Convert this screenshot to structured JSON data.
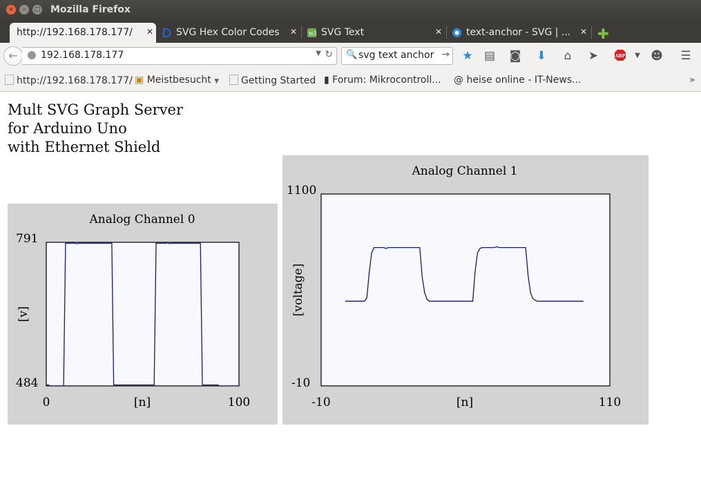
{
  "window": {
    "title": "Mozilla Firefox"
  },
  "tabs": [
    {
      "label": "http://192.168.178.177/",
      "active": true,
      "icon": "none"
    },
    {
      "label": "SVG Hex Color Codes",
      "active": false,
      "icon": "d-logo-icon"
    },
    {
      "label": "SVG Text",
      "active": false,
      "icon": "w3-icon"
    },
    {
      "label": "text-anchor - SVG | ...",
      "active": false,
      "icon": "mdn-icon"
    }
  ],
  "navigation": {
    "url": "192.168.178.177",
    "search_value": "svg text anchor"
  },
  "bookmarks": [
    {
      "label": "http://192.168.178.177/"
    },
    {
      "label": "Meistbesucht"
    },
    {
      "label": "Getting Started"
    },
    {
      "label": "Forum: Mikrocontroll..."
    },
    {
      "label": "heise online - IT-News..."
    }
  ],
  "page": {
    "title_lines": [
      "Mult SVG Graph Server",
      "for Arduino Uno",
      "with Ethernet Shield"
    ]
  },
  "colors": {
    "panel": "#d3d3d3",
    "plot_bg": "#f8f8ff",
    "line": "#191970"
  },
  "chart_data": [
    {
      "type": "line",
      "title": "Analog Channel 0",
      "xlabel": "[n]",
      "ylabel": "[v]",
      "xlim": [
        0,
        100
      ],
      "ylim": [
        484,
        791
      ],
      "x_tick_labels": [
        "0",
        "100"
      ],
      "y_tick_labels": [
        "791",
        "484"
      ],
      "grid": false,
      "series": [
        {
          "x": [
            0,
            1,
            2,
            3,
            4,
            5,
            6,
            7,
            8,
            9,
            10,
            11,
            12,
            13,
            14,
            15,
            16,
            17,
            18,
            19,
            20,
            21,
            22,
            23,
            24,
            25,
            26,
            27,
            28,
            29,
            30,
            31,
            32,
            33,
            34,
            35,
            36,
            37,
            38,
            39,
            40,
            41,
            42,
            43,
            44,
            45,
            46,
            47,
            48,
            49,
            50,
            51,
            52,
            53,
            54,
            55,
            56,
            57,
            58,
            59,
            60,
            61,
            62,
            63,
            64,
            65,
            66,
            67,
            68,
            69,
            70,
            71,
            72,
            73,
            74,
            75,
            76,
            77,
            78,
            79,
            80,
            81,
            82,
            83,
            84,
            85,
            86,
            87,
            88,
            89,
            90,
            91,
            92,
            93,
            94,
            95,
            96,
            97,
            98,
            99
          ],
          "y": [
            486,
            486,
            484,
            484,
            484,
            484,
            484,
            484,
            484,
            484,
            789,
            789,
            789,
            789,
            789,
            789,
            788,
            789,
            789,
            789,
            789,
            789,
            789,
            789,
            789,
            789,
            789,
            789,
            789,
            789,
            789,
            789,
            789,
            789,
            789,
            486,
            486,
            486,
            486,
            486,
            486,
            486,
            486,
            486,
            486,
            486,
            486,
            486,
            486,
            486,
            486,
            486,
            486,
            486,
            486,
            486,
            486,
            789,
            789,
            789,
            789,
            789,
            789,
            790,
            788,
            789,
            789,
            789,
            789,
            789,
            789,
            789,
            789,
            789,
            789,
            789,
            789,
            789,
            789,
            789,
            789,
            486,
            486,
            486,
            486,
            486,
            486,
            486,
            486,
            486,
            484,
            484,
            484,
            484,
            484,
            484,
            484,
            484,
            484,
            484
          ]
        }
      ]
    },
    {
      "type": "line",
      "title": "Analog Channel 1",
      "xlabel": "[n]",
      "ylabel": "[voltage]",
      "xlim": [
        -10,
        110
      ],
      "ylim": [
        -10,
        1100
      ],
      "x_tick_labels": [
        "-10",
        "110"
      ],
      "y_tick_labels": [
        "1100",
        "-10"
      ],
      "grid": false,
      "series": [
        {
          "x": [
            0,
            1,
            2,
            3,
            4,
            5,
            6,
            7,
            8,
            9,
            10,
            11,
            12,
            13,
            14,
            15,
            16,
            17,
            18,
            19,
            20,
            21,
            22,
            23,
            24,
            25,
            26,
            27,
            28,
            29,
            30,
            31,
            32,
            33,
            34,
            35,
            36,
            37,
            38,
            39,
            40,
            41,
            42,
            43,
            44,
            45,
            46,
            47,
            48,
            49,
            50,
            51,
            52,
            53,
            54,
            55,
            56,
            57,
            58,
            59,
            60,
            61,
            62,
            63,
            64,
            65,
            66,
            67,
            68,
            69,
            70,
            71,
            72,
            73,
            74,
            75,
            76,
            77,
            78,
            79,
            80,
            81,
            82,
            83,
            84,
            85,
            86,
            87,
            88,
            89,
            90,
            91,
            92,
            93,
            94,
            95,
            96,
            97,
            98,
            99
          ],
          "y": [
            480,
            480,
            480,
            480,
            480,
            480,
            480,
            480,
            480,
            500,
            650,
            760,
            790,
            790,
            790,
            790,
            790,
            785,
            790,
            790,
            790,
            790,
            790,
            790,
            790,
            790,
            790,
            790,
            790,
            790,
            790,
            790,
            620,
            530,
            490,
            480,
            480,
            480,
            480,
            480,
            480,
            480,
            480,
            480,
            480,
            480,
            480,
            480,
            480,
            480,
            480,
            480,
            480,
            480,
            650,
            760,
            785,
            790,
            790,
            790,
            790,
            790,
            790,
            795,
            790,
            790,
            790,
            790,
            790,
            790,
            790,
            790,
            790,
            790,
            790,
            790,
            630,
            530,
            495,
            485,
            480,
            480,
            480,
            480,
            480,
            480,
            480,
            480,
            480,
            480,
            480,
            480,
            480,
            480,
            480,
            480,
            480,
            480,
            480,
            480
          ]
        }
      ]
    }
  ]
}
